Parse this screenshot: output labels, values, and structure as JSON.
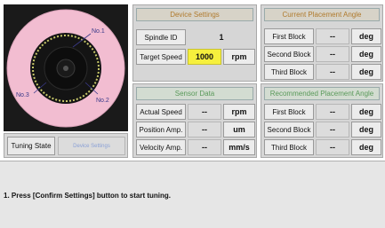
{
  "disc": {
    "labels": [
      "No.1",
      "No.3",
      "No.2"
    ],
    "colors": {
      "disc": "#f2bdd1",
      "hub": "#111111",
      "ring": "#c9c96a",
      "label": "#3a3a8a"
    }
  },
  "tuning": {
    "label": "Tuning State",
    "value": "Device Settings"
  },
  "device_settings": {
    "title": "Device Settings",
    "spindle_label": "Spindle ID",
    "spindle_value": "1",
    "speed_label": "Target Speed",
    "speed_value": "1000",
    "speed_unit": "rpm"
  },
  "sensor_data": {
    "title": "Sensor Data",
    "rows": [
      {
        "label": "Actual Speed",
        "value": "--",
        "unit": "rpm"
      },
      {
        "label": "Position Amp.",
        "value": "--",
        "unit": "um"
      },
      {
        "label": "Velocity Amp.",
        "value": "--",
        "unit": "mm/s"
      }
    ]
  },
  "current_angle": {
    "title": "Current Placement Angle",
    "rows": [
      {
        "label": "First Block",
        "value": "--",
        "unit": "deg"
      },
      {
        "label": "Second Block",
        "value": "--",
        "unit": "deg"
      },
      {
        "label": "Third Block",
        "value": "--",
        "unit": "deg"
      }
    ]
  },
  "recommended_angle": {
    "title": "Recommended Placement Angle",
    "rows": [
      {
        "label": "First Block",
        "value": "--",
        "unit": "deg"
      },
      {
        "label": "Second Block",
        "value": "--",
        "unit": "deg"
      },
      {
        "label": "Third Block",
        "value": "--",
        "unit": "deg"
      }
    ]
  },
  "message": {
    "text": "1. Press [Confirm Settings] button to start tuning."
  }
}
